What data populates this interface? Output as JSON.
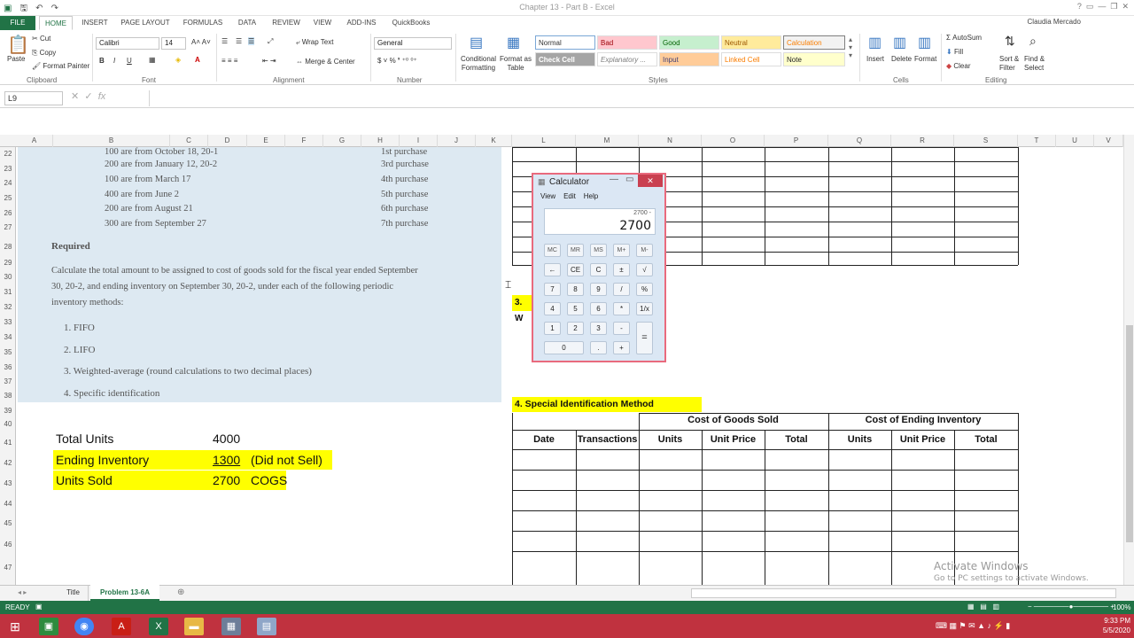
{
  "window": {
    "title": "Chapter 13 - Part B - Excel",
    "user": "Claudia Mercado"
  },
  "tabs": [
    "FILE",
    "HOME",
    "INSERT",
    "PAGE LAYOUT",
    "FORMULAS",
    "DATA",
    "REVIEW",
    "VIEW",
    "ADD-INS",
    "QuickBooks"
  ],
  "ribbon": {
    "clipboard": {
      "paste": "Paste",
      "cut": "Cut",
      "copy": "Copy",
      "format_painter": "Format Painter",
      "label": "Clipboard"
    },
    "font": {
      "name": "Calibri",
      "size": "14",
      "label": "Font"
    },
    "alignment": {
      "wrap": "Wrap Text",
      "merge": "Merge & Center",
      "label": "Alignment"
    },
    "number": {
      "format": "General",
      "label": "Number"
    },
    "styles": {
      "cond": "Conditional Formatting",
      "table": "Format as Table",
      "normal": "Normal",
      "bad": "Bad",
      "good": "Good",
      "neutral": "Neutral",
      "calculation": "Calculation",
      "check": "Check Cell",
      "explanatory": "Explanatory ...",
      "input": "Input",
      "linked": "Linked Cell",
      "note": "Note",
      "label": "Styles"
    },
    "cells": {
      "insert": "Insert",
      "delete": "Delete",
      "format": "Format",
      "label": "Cells"
    },
    "editing": {
      "autosum": "AutoSum",
      "fill": "Fill",
      "clear": "Clear",
      "sort": "Sort & Filter",
      "find": "Find & Select",
      "label": "Editing"
    }
  },
  "formula_bar": {
    "name_box": "L9",
    "fx": "fx",
    "value": ""
  },
  "columns": [
    "A",
    "B",
    "C",
    "D",
    "E",
    "F",
    "G",
    "H",
    "I",
    "J",
    "K",
    "L",
    "M",
    "N",
    "O",
    "P",
    "Q",
    "R",
    "S",
    "T",
    "U",
    "V"
  ],
  "rows": [
    "22",
    "23",
    "24",
    "25",
    "26",
    "27",
    "28",
    "29",
    "30",
    "31",
    "32",
    "33",
    "34",
    "35",
    "36",
    "37",
    "38",
    "39",
    "40",
    "41",
    "42",
    "43",
    "44",
    "45",
    "46",
    "47"
  ],
  "problem": {
    "purchases": [
      {
        "desc": "100 are from October 18, 20-1",
        "label": "1st purchase"
      },
      {
        "desc": "200 are from January 12, 20-2",
        "label": "3rd purchase"
      },
      {
        "desc": "100 are from March 17",
        "label": "4th purchase"
      },
      {
        "desc": "400 are from June 2",
        "label": "5th purchase"
      },
      {
        "desc": "200 are from August 21",
        "label": "6th purchase"
      },
      {
        "desc": "300 are from September 27",
        "label": "7th purchase"
      }
    ],
    "required_title": "Required",
    "required_l1": "Calculate the total amount to be assigned to cost of goods sold for the fiscal year ended September",
    "required_l2": "30, 20-2, and ending inventory on September 30, 20-2, under each of the following periodic",
    "required_l3": "inventory methods:",
    "methods": [
      "1. FIFO",
      "2. LIFO",
      "3. Weighted-average (round calculations to two decimal places)",
      "4. Specific identification"
    ]
  },
  "summary": {
    "total_label": "Total Units",
    "total_value": "4000",
    "ending_label": "Ending Inventory",
    "ending_value": "1300",
    "ending_note": "(Did not Sell)",
    "sold_label": "Units Sold",
    "sold_value": "2700",
    "sold_note": "COGS"
  },
  "partial_label": "3. W",
  "special": {
    "title": "4. Special Identification Method",
    "cogs": "Cost of Goods Sold",
    "ending": "Cost of Ending Inventory",
    "headers": [
      "Date",
      "Transactions",
      "Units",
      "Unit Price",
      "Total",
      "Units",
      "Unit Price",
      "Total"
    ]
  },
  "calculator": {
    "title": "Calculator",
    "menu": [
      "View",
      "Edit",
      "Help"
    ],
    "expression": "2700 -",
    "display": "2700",
    "rows": [
      [
        "MC",
        "MR",
        "MS",
        "M+",
        "M-"
      ],
      [
        "←",
        "CE",
        "C",
        "±",
        "√"
      ],
      [
        "7",
        "8",
        "9",
        "/",
        "%"
      ],
      [
        "4",
        "5",
        "6",
        "*",
        "1/x"
      ],
      [
        "1",
        "2",
        "3",
        "-"
      ],
      [
        "0",
        ".",
        "+"
      ]
    ],
    "equals": "="
  },
  "sheet_tabs": [
    "Title",
    "Problem 13-6A"
  ],
  "status": {
    "mode": "READY",
    "zoom": "100%"
  },
  "watermark": {
    "l1": "Activate Windows",
    "l2": "Go to PC settings to activate Windows."
  },
  "clock": {
    "time": "9:33 PM",
    "date": "5/5/2020"
  }
}
